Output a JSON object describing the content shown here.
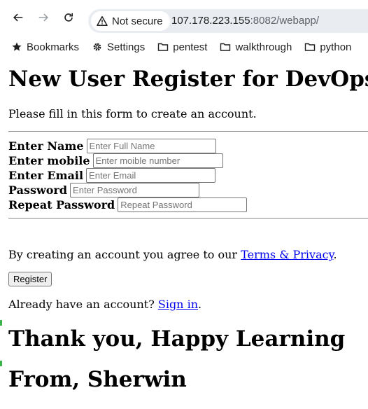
{
  "browser": {
    "security_label": "Not secure",
    "url_host": "107.178.223.155",
    "url_rest": ":8082/webapp/",
    "bookmarks": [
      {
        "label": "Bookmarks",
        "icon": "star-icon"
      },
      {
        "label": "Settings",
        "icon": "gear-icon"
      },
      {
        "label": "pentest",
        "icon": "folder-icon"
      },
      {
        "label": "walkthrough",
        "icon": "folder-icon"
      },
      {
        "label": "python",
        "icon": "folder-icon"
      }
    ]
  },
  "page": {
    "title": "New User Register for DevOps Learning",
    "intro": "Please fill in this form to create an account.",
    "form": {
      "name_label": "Enter Name",
      "name_placeholder": "Enter Full Name",
      "mobile_label": "Enter mobile",
      "mobile_placeholder": "Enter moible number",
      "email_label": "Enter Email",
      "email_placeholder": "Enter Email",
      "password_label": "Password",
      "password_placeholder": "Enter Password",
      "repeat_label": "Repeat Password",
      "repeat_placeholder": "Repeat Password"
    },
    "terms_prefix": "By creating an account you agree to our ",
    "terms_link": "Terms & Privacy",
    "terms_suffix": ".",
    "register_button": "Register",
    "signin_prefix": "Already have an account? ",
    "signin_link": "Sign in",
    "signin_suffix": ".",
    "thanks": "Thank you, Happy Learning",
    "from": "From, Sherwin"
  },
  "colors": {
    "link": "#0000ee",
    "omnibox_bg": "#e9ecf1"
  }
}
